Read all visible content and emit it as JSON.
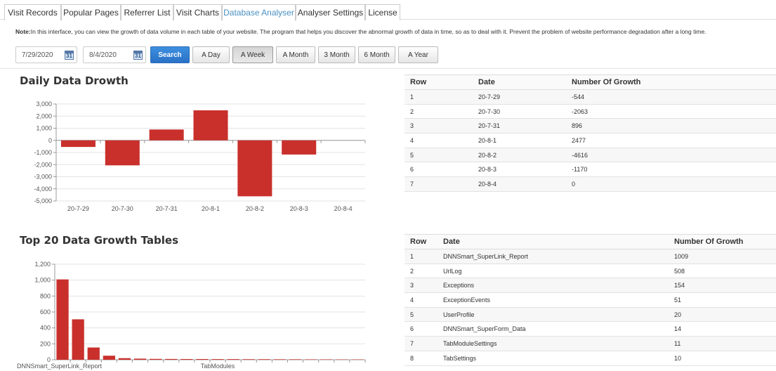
{
  "tabs": [
    {
      "label": "Visit Records",
      "active": false
    },
    {
      "label": "Popular Pages",
      "active": false
    },
    {
      "label": "Referrer List",
      "active": false
    },
    {
      "label": "Visit Charts",
      "active": false
    },
    {
      "label": "Database Analyser",
      "active": true
    },
    {
      "label": "Analyser Settings",
      "active": false
    },
    {
      "label": "License",
      "active": false
    }
  ],
  "note": {
    "prefix": "Note:",
    "text": "In this interface, you can view the growth of data volume in each table of your website. The program that helps you discover the abnormal growth of data in time, so as to deal with it. Prevent the problem of website performance degradation after a long time."
  },
  "toolbar": {
    "start_date": "7/29/2020",
    "end_date": "8/4/2020",
    "calendar_glyph": "31",
    "search_label": "Search",
    "ranges": [
      {
        "label": "A Day",
        "selected": false
      },
      {
        "label": "A Week",
        "selected": true
      },
      {
        "label": "A Month",
        "selected": false
      },
      {
        "label": "3 Month",
        "selected": false
      },
      {
        "label": "6 Month",
        "selected": false
      },
      {
        "label": "A Year",
        "selected": false
      }
    ]
  },
  "daily": {
    "title": "Daily Data Drowth",
    "table": {
      "headers": [
        "Row",
        "Date",
        "Number Of Growth"
      ],
      "rows": [
        [
          "1",
          "20-7-29",
          "-544"
        ],
        [
          "2",
          "20-7-30",
          "-2063"
        ],
        [
          "3",
          "20-7-31",
          "896"
        ],
        [
          "4",
          "20-8-1",
          "2477"
        ],
        [
          "5",
          "20-8-2",
          "-4616"
        ],
        [
          "6",
          "20-8-3",
          "-1170"
        ],
        [
          "7",
          "20-8-4",
          "0"
        ]
      ]
    }
  },
  "top20": {
    "title": "Top 20 Data Growth Tables",
    "table": {
      "headers": [
        "Row",
        "Date",
        "Number Of Growth"
      ],
      "rows": [
        [
          "1",
          "DNNSmart_SuperLink_Report",
          "1009"
        ],
        [
          "2",
          "UrlLog",
          "508"
        ],
        [
          "3",
          "Exceptions",
          "154"
        ],
        [
          "4",
          "ExceptionEvents",
          "51"
        ],
        [
          "5",
          "UserProfile",
          "20"
        ],
        [
          "6",
          "DNNSmart_SuperForm_Data",
          "14"
        ],
        [
          "7",
          "TabModuleSettings",
          "11"
        ],
        [
          "8",
          "TabSettings",
          "10"
        ]
      ]
    }
  },
  "chart_data": [
    {
      "type": "bar",
      "title": "Daily Data Drowth",
      "categories": [
        "20-7-29",
        "20-7-30",
        "20-7-31",
        "20-8-1",
        "20-8-2",
        "20-8-3",
        "20-8-4"
      ],
      "values": [
        -544,
        -2063,
        896,
        2477,
        -4616,
        -1170,
        0
      ],
      "ylim": [
        -5000,
        3000
      ],
      "yticks": [
        3000,
        2000,
        1000,
        0,
        -1000,
        -2000,
        -3000,
        -4000,
        -5000
      ],
      "ytick_labels": [
        "3,000",
        "2,000",
        "1,000",
        "0",
        "-1,000",
        "-2,000",
        "-3,000",
        "-4,000",
        "-5,000"
      ],
      "grid": true,
      "color": "#c9302c"
    },
    {
      "type": "bar",
      "title": "Top 20 Data Growth Tables",
      "categories": [
        "DNNSmart_SuperLink_Report",
        "UrlLog",
        "Exceptions",
        "ExceptionEvents",
        "UserProfile",
        "DNNSmart_SuperForm_Data",
        "TabModuleSettings",
        "TabSettings",
        "",
        "",
        "",
        "",
        "",
        "",
        "",
        "",
        "",
        "",
        "",
        ""
      ],
      "values": [
        1009,
        508,
        154,
        51,
        20,
        14,
        11,
        10,
        9,
        9,
        8,
        8,
        7,
        7,
        6,
        6,
        5,
        5,
        4,
        4
      ],
      "visible_xlabels": [
        "DNNSmart_SuperLink_Report",
        "TabModules"
      ],
      "ylim": [
        0,
        1200
      ],
      "yticks": [
        1200,
        1000,
        800,
        600,
        400,
        200,
        0
      ],
      "ytick_labels": [
        "1,200",
        "1,000",
        "800",
        "600",
        "400",
        "200",
        "0"
      ],
      "grid": true,
      "color": "#c9302c"
    }
  ]
}
